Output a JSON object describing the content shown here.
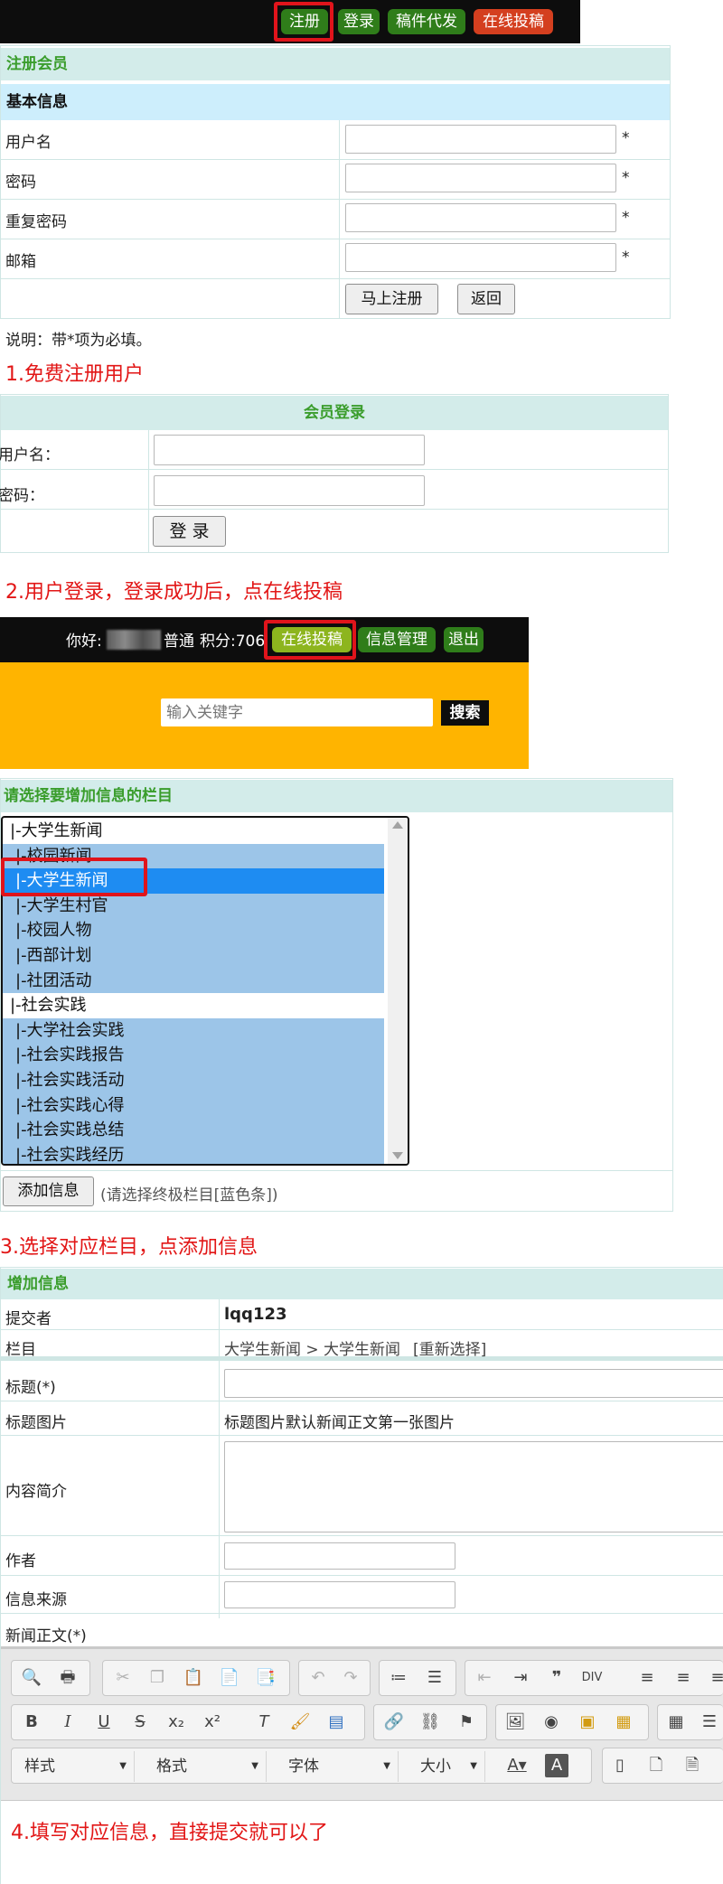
{
  "top_nav": {
    "register": "注册",
    "login": "登录",
    "proxy": "稿件代发",
    "online": "在线投稿"
  },
  "register_form": {
    "title": "注册会员",
    "section": "基本信息",
    "fields": [
      {
        "label": "用户名",
        "value": "",
        "required": "*"
      },
      {
        "label": "密码",
        "value": "",
        "required": "*"
      },
      {
        "label": "重复密码",
        "value": "",
        "required": "*"
      },
      {
        "label": "邮箱",
        "value": "",
        "required": "*"
      }
    ],
    "submit": "马上注册",
    "back": "返回",
    "note": "说明：带*项为必填。"
  },
  "step1": "1.免费注册用户",
  "login_form": {
    "title": "会员登录",
    "username_label": "用户名：",
    "password_label": "密码：",
    "username": "",
    "password": "",
    "submit": "登 录"
  },
  "step2": "2.用户登录，登录成功后，点在线投稿",
  "member_bar": {
    "greeting": "你好:",
    "level": "普通",
    "points": "积分:706",
    "submit_online": "在线投稿",
    "info_manage": "信息管理",
    "logout": "退出"
  },
  "search": {
    "placeholder": "输入关键字",
    "button": "搜索"
  },
  "category_select": {
    "title": "请选择要增加信息的栏目",
    "items": [
      {
        "label": "|-大学生新闻",
        "state": "parent"
      },
      {
        "label": "|-校园新闻",
        "state": "leaf"
      },
      {
        "label": "|-大学生新闻",
        "state": "selected"
      },
      {
        "label": "|-大学生村官",
        "state": "leaf"
      },
      {
        "label": "|-校园人物",
        "state": "leaf"
      },
      {
        "label": "|-西部计划",
        "state": "leaf"
      },
      {
        "label": "|-社团活动",
        "state": "leaf"
      },
      {
        "label": "|-社会实践",
        "state": "parent"
      },
      {
        "label": "|-大学社会实践",
        "state": "leaf"
      },
      {
        "label": "|-社会实践报告",
        "state": "leaf"
      },
      {
        "label": "|-社会实践活动",
        "state": "leaf"
      },
      {
        "label": "|-社会实践心得",
        "state": "leaf"
      },
      {
        "label": "|-社会实践总结",
        "state": "leaf"
      },
      {
        "label": "|-社会实践经历",
        "state": "leaf"
      }
    ],
    "add_button": "添加信息",
    "hint": "(请选择终极栏目[蓝色条])"
  },
  "step3": "3.选择对应栏目，点添加信息",
  "add_info": {
    "title": "增加信息",
    "submitter_label": "提交者",
    "submitter": "lqq123",
    "column_label": "栏目",
    "column_path": "大学生新闻 > 大学生新闻",
    "reselect": "[重新选择]",
    "title_label": "标题(*)",
    "title_value": "",
    "title_image_label": "标题图片",
    "title_image_note": "标题图片默认新闻正文第一张图片",
    "summary_label": "内容简介",
    "summary": "",
    "author_label": "作者",
    "author": "",
    "source_label": "信息来源",
    "source": "",
    "body_label": "新闻正文(*)"
  },
  "editor": {
    "dropdowns": [
      "样式",
      "格式",
      "字体",
      "大小"
    ]
  },
  "step4": "4.填写对应信息，直接提交就可以了",
  "colors": {
    "accent_green": "#3a9d2c",
    "annotation_red": "#e21616",
    "header_orange": "#ffb400",
    "selected_blue": "#1e8cf2",
    "leaf_blue": "#9cc5e8"
  }
}
